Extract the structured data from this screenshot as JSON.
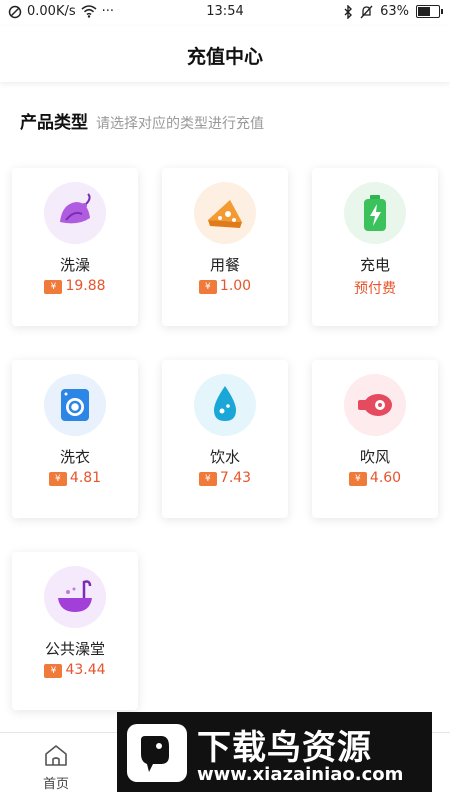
{
  "status_bar": {
    "network_speed": "0.00K/s",
    "dots": "···",
    "time": "13:54",
    "battery_text": "63%",
    "battery_level": 0.63
  },
  "header": {
    "title": "充值中心"
  },
  "section": {
    "title": "产品类型",
    "subtitle": "请选择对应的类型进行充值"
  },
  "products": [
    {
      "name": "洗澡",
      "price": "19.88",
      "icon": "shower-icon",
      "color": "#a64bd9",
      "has_yen": true
    },
    {
      "name": "用餐",
      "price": "1.00",
      "icon": "meal-icon",
      "color": "#f08a2a",
      "has_yen": true
    },
    {
      "name": "充电",
      "price": "预付费",
      "icon": "charge-battery-icon",
      "color": "#2fb44f",
      "has_yen": false
    },
    {
      "name": "洗衣",
      "price": "4.81",
      "icon": "washing-machine-icon",
      "color": "#2c86e6",
      "has_yen": true
    },
    {
      "name": "饮水",
      "price": "7.43",
      "icon": "water-drop-icon",
      "color": "#1aa6d6",
      "has_yen": true
    },
    {
      "name": "吹风",
      "price": "4.60",
      "icon": "hair-dryer-icon",
      "color": "#e64a5e",
      "has_yen": true
    },
    {
      "name": "公共澡堂",
      "price": "43.44",
      "icon": "bathtub-icon",
      "color": "#a23fd8",
      "has_yen": true
    }
  ],
  "yen_symbol": "¥",
  "tabbar": {
    "home_label": "首页"
  },
  "watermark": {
    "title": "下载鸟资源",
    "url": "www.xiazainiao.com"
  }
}
